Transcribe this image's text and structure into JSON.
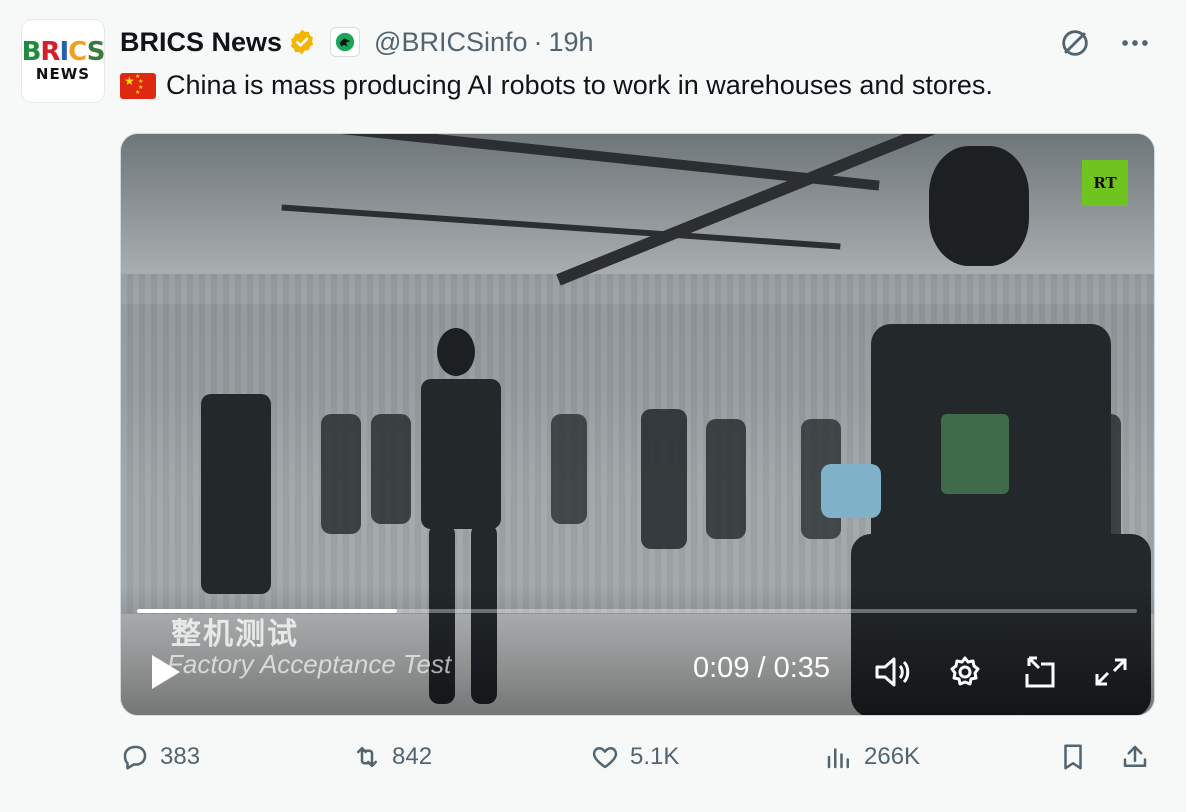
{
  "author": {
    "display_name": "BRICS News",
    "handle": "@BRICSinfo",
    "separator": "·",
    "time": "19h",
    "avatar_logo_top": [
      "B",
      "R",
      "I",
      "C",
      "S"
    ],
    "avatar_logo_bottom": "NEWS",
    "verified_icon": "gold-verified-badge",
    "affiliation_icon": "affiliate-badge"
  },
  "tweet": {
    "flag": "china-flag",
    "text": "China is mass producing AI robots to work in warehouses and stores."
  },
  "media": {
    "watermark": "RT",
    "caption_cn": "整机测试",
    "caption_en": "Factory Acceptance Test",
    "current_time": "0:09",
    "duration": "0:35",
    "time_display": "0:09 / 0:35",
    "progress": 0.26
  },
  "actions": {
    "replies": "383",
    "reposts": "842",
    "likes": "5.1K",
    "views": "266K"
  },
  "colors": {
    "accent_verified": "#f4b400",
    "muted_text": "#536471",
    "background": "#f7f9f9",
    "rt_green": "#6fc41f"
  }
}
